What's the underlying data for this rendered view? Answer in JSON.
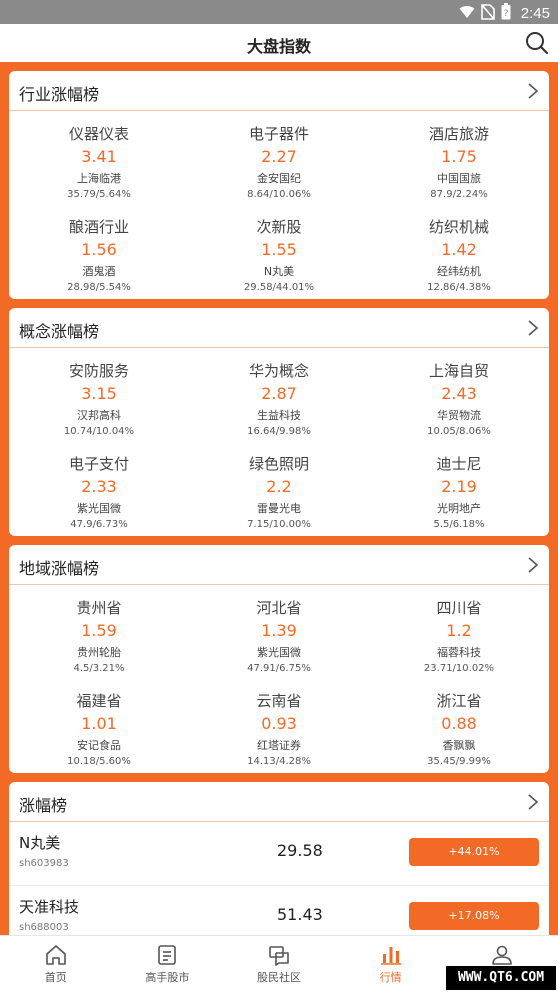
{
  "status_bar": {
    "time": "2:45"
  },
  "header": {
    "title": "大盘指数"
  },
  "sections": [
    {
      "title": "行业涨幅榜",
      "items": [
        {
          "name": "仪器仪表",
          "value": "3.41",
          "stock": "上海临港",
          "pct": "35.79/5.64%"
        },
        {
          "name": "电子器件",
          "value": "2.27",
          "stock": "金安国纪",
          "pct": "8.64/10.06%"
        },
        {
          "name": "酒店旅游",
          "value": "1.75",
          "stock": "中国国旅",
          "pct": "87.9/2.24%"
        },
        {
          "name": "酿酒行业",
          "value": "1.56",
          "stock": "酒鬼酒",
          "pct": "28.98/5.54%"
        },
        {
          "name": "次新股",
          "value": "1.55",
          "stock": "N丸美",
          "pct": "29.58/44.01%"
        },
        {
          "name": "纺织机械",
          "value": "1.42",
          "stock": "经纬纺机",
          "pct": "12.86/4.38%"
        }
      ]
    },
    {
      "title": "概念涨幅榜",
      "items": [
        {
          "name": "安防服务",
          "value": "3.15",
          "stock": "汉邦高科",
          "pct": "10.74/10.04%"
        },
        {
          "name": "华为概念",
          "value": "2.87",
          "stock": "生益科技",
          "pct": "16.64/9.98%"
        },
        {
          "name": "上海自贸",
          "value": "2.43",
          "stock": "华贸物流",
          "pct": "10.05/8.06%"
        },
        {
          "name": "电子支付",
          "value": "2.33",
          "stock": "紫光国微",
          "pct": "47.9/6.73%"
        },
        {
          "name": "绿色照明",
          "value": "2.2",
          "stock": "雷曼光电",
          "pct": "7.15/10.00%"
        },
        {
          "name": "迪士尼",
          "value": "2.19",
          "stock": "光明地产",
          "pct": "5.5/6.18%"
        }
      ]
    },
    {
      "title": "地域涨幅榜",
      "items": [
        {
          "name": "贵州省",
          "value": "1.59",
          "stock": "贵州轮胎",
          "pct": "4.5/3.21%"
        },
        {
          "name": "河北省",
          "value": "1.39",
          "stock": "紫光国微",
          "pct": "47.91/6.75%"
        },
        {
          "name": "四川省",
          "value": "1.2",
          "stock": "福蓉科技",
          "pct": "23.71/10.02%"
        },
        {
          "name": "福建省",
          "value": "1.01",
          "stock": "安记食品",
          "pct": "10.18/5.60%"
        },
        {
          "name": "云南省",
          "value": "0.93",
          "stock": "红塔证券",
          "pct": "14.13/4.28%"
        },
        {
          "name": "浙江省",
          "value": "0.88",
          "stock": "香飘飘",
          "pct": "35.45/9.99%"
        }
      ]
    }
  ],
  "gainers": {
    "title": "涨幅榜",
    "rows": [
      {
        "name": "N丸美",
        "code": "sh603983",
        "price": "29.58",
        "change": "+44.01%"
      },
      {
        "name": "天准科技",
        "code": "sh688003",
        "price": "51.43",
        "change": "+17.08%"
      }
    ]
  },
  "tabs": [
    {
      "label": "首页",
      "icon": "home-icon"
    },
    {
      "label": "高手股市",
      "icon": "document-icon"
    },
    {
      "label": "股民社区",
      "icon": "community-icon"
    },
    {
      "label": "行情",
      "icon": "bar-chart-icon",
      "active": true
    },
    {
      "label": "我的",
      "icon": "user-icon"
    }
  ],
  "watermark": "WWW.QT6.COM",
  "colors": {
    "accent": "#f36a27",
    "status_bar": "#8a8a8a"
  }
}
